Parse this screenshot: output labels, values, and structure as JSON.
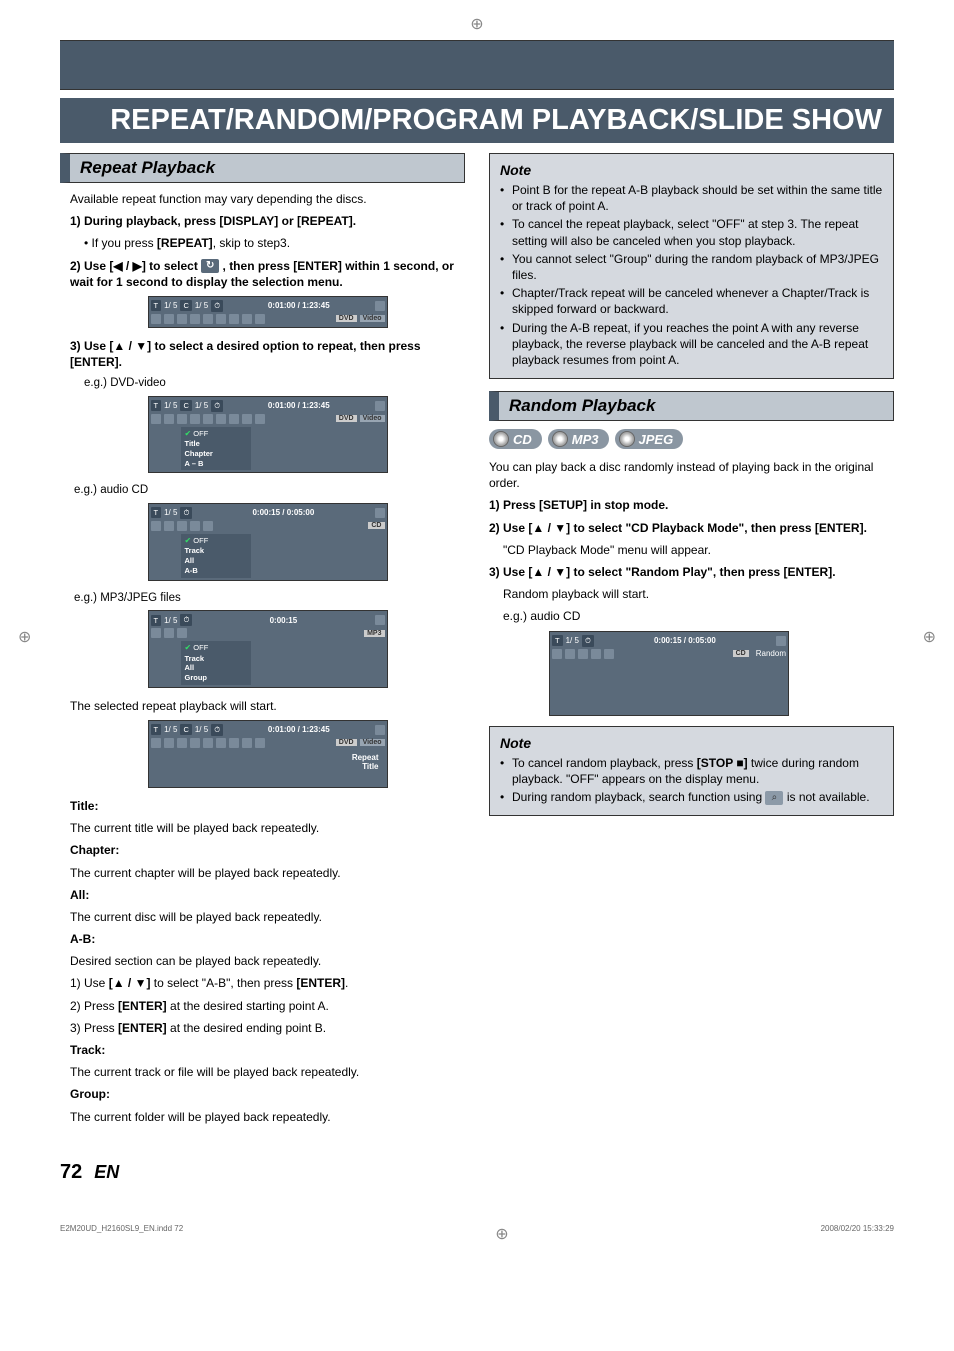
{
  "main_title": "REPEAT/RANDOM/PROGRAM PLAYBACK/SLIDE SHOW",
  "section_repeat": "Repeat Playback",
  "section_random": "Random Playback",
  "intro_repeat": "Available repeat function may vary depending the discs.",
  "step1": {
    "label": "1) During playback, press [DISPLAY] or [REPEAT].",
    "bullet": "• If you press ",
    "bullet_b": "[REPEAT]",
    "bullet_tail": ", skip to step3."
  },
  "step2": {
    "pre": "2) Use [",
    "mid": "] to select ",
    "post": " , then press [ENTER] within 1 second, or wait for 1 second to display the selection menu."
  },
  "step3": {
    "pre": "3) Use [",
    "post": "] to select a desired option to repeat, then press [ENTER]."
  },
  "eg_dvd": "e.g.) DVD-video",
  "eg_cd": "e.g.) audio CD",
  "eg_mp3": "e.g.) MP3/JPEG files",
  "selected_start": "The selected repeat playback will start.",
  "defs": {
    "title_h": "Title:",
    "title_t": "The current title will be played back repeatedly.",
    "chapter_h": "Chapter:",
    "chapter_t": "The current chapter will be played back repeatedly.",
    "all_h": "All:",
    "all_t": "The current disc will be played back repeatedly.",
    "ab_h": "A-B:",
    "ab_t": "Desired section can be played back repeatedly.",
    "ab_1a": "1) Use ",
    "ab_1b": " to select \"A-B\", then press ",
    "ab_1c": "[ENTER]",
    "ab_2a": "2) Press ",
    "ab_2b": "[ENTER]",
    "ab_2c": " at the desired starting point A.",
    "ab_3a": "3) Press ",
    "ab_3b": "[ENTER]",
    "ab_3c": " at the desired ending point B.",
    "track_h": "Track:",
    "track_t": "The current track or file will be played back repeatedly.",
    "group_h": "Group:",
    "group_t": "The current folder will be played back repeatedly."
  },
  "note1_title": "Note",
  "note1_items": [
    "Point B for the repeat A-B playback should be set within the same title or track of point A.",
    "To cancel the repeat playback, select \"OFF\" at step 3. The repeat setting will also be canceled when you stop playback.",
    "You cannot select \"Group\" during the random playback of MP3/JPEG files.",
    "Chapter/Track repeat will be canceled whenever a Chapter/Track is skipped forward or backward.",
    "During the A-B repeat, if you reaches the point A with any reverse playback, the reverse playback will be canceled and the A-B repeat playback resumes from point A."
  ],
  "media_badges": [
    "CD",
    "MP3",
    "JPEG"
  ],
  "random_intro": "You can play back a disc randomly instead of playing back in the original order.",
  "r_step1": "1) Press [SETUP] in stop mode.",
  "r_step2": {
    "pre": "2) Use [",
    "post": "] to select \"CD Playback Mode\", then press [ENTER].",
    "sub": "\"CD Playback Mode\" menu will appear."
  },
  "r_step3": {
    "pre": "3) Use [",
    "post": "] to select \"Random Play\", then press [ENTER].",
    "sub1": "Random playback will start.",
    "sub2": "e.g.) audio CD"
  },
  "note2_title": "Note",
  "note2_item1a": "To cancel random playback, press ",
  "note2_item1b": "[STOP ",
  "note2_item1c": "]",
  "note2_item1d": " twice during random playback. \"OFF\" appears on the display menu.",
  "note2_item2a": "During random playback, search function using ",
  "note2_item2b": " is not available.",
  "arrows_lr": "◀ / ▶",
  "arrows_ud": "▲ / ▼",
  "stop_sym": "■",
  "osd1": {
    "tc": "1/  5",
    "cc": "1/  5",
    "time": "0:01:00 / 1:23:45",
    "badge1": "DVD",
    "badge2": "Video"
  },
  "osd2": {
    "tc": "1/  5",
    "cc": "1/  5",
    "time": "0:01:00 / 1:23:45",
    "badge1": "DVD",
    "badge2": "Video",
    "menu": [
      "OFF",
      "Title",
      "Chapter",
      "A – B"
    ]
  },
  "osd3": {
    "tc": "1/  5",
    "time": "0:00:15 / 0:05:00",
    "badge": "CD",
    "menu": [
      "OFF",
      "Track",
      "All",
      "A-B"
    ]
  },
  "osd4": {
    "tc": "1/  5",
    "time": "0:00:15",
    "badge": "MP3",
    "menu": [
      "OFF",
      "Track",
      "All",
      "Group"
    ]
  },
  "osd5": {
    "tc": "1/  5",
    "cc": "1/  5",
    "time": "0:01:00 / 1:23:45",
    "badge1": "DVD",
    "badge2": "Video",
    "status1": "Repeat",
    "status2": "Title"
  },
  "osd_random": {
    "tc": "1/  5",
    "time": "0:00:15 / 0:05:00",
    "badge": "CD",
    "status": "Random"
  },
  "page_num": "72",
  "page_lang": "EN",
  "footer_file": "E2M20UD_H2160SL9_EN.indd   72",
  "footer_time": "2008/02/20   15:33:29"
}
